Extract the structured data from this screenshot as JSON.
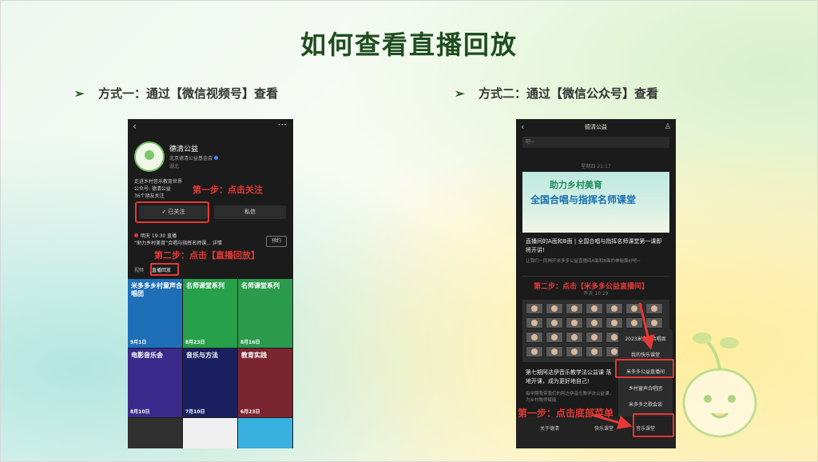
{
  "slide": {
    "title": "如何查看直播回放",
    "method1": "方式一：通过【微信视频号】查看",
    "method2": "方式二：通过【微信公众号】查看",
    "bullet": "➢"
  },
  "phone1": {
    "back": "‹",
    "more": "···",
    "account_name": "德清公益",
    "org": "北京德清公益基金会",
    "location": "湖北",
    "desc1": "走进乡村音乐教育世界",
    "desc2": "公众号: 德清公益",
    "desc3": "36个朋友关注",
    "follow_label": "✓ 已关注",
    "message_label": "私信",
    "live_line1": "明天 19:30 直播",
    "live_line2": "“助力乡村美育”合唱与指挥名师课... 详情",
    "book_label": "预约",
    "tabs": [
      "视频",
      "直播回放"
    ],
    "step1": "第一步：点击关注",
    "step2": "第二步：点击【直播回放】",
    "thumbs": [
      {
        "caption": "米多多乡村童声合唱团",
        "date": "9月1日",
        "color": "#1e6fb8"
      },
      {
        "caption": "名师课堂系列",
        "date": "8月23日",
        "color": "#27a04a"
      },
      {
        "caption": "名师课堂系列",
        "date": "8月16日",
        "color": "#2b9a4c"
      },
      {
        "caption": "电影音乐会",
        "date": "8月10日",
        "color": "#3a2a8c"
      },
      {
        "caption": "音乐与方法",
        "date": "7月10日",
        "color": "#1a2060"
      },
      {
        "caption": "教育实践",
        "date": "6月23日",
        "color": "#7a2530"
      },
      {
        "caption": "",
        "date": "",
        "color": "#303030"
      },
      {
        "caption": "",
        "date": "",
        "color": "#f0f0f0"
      },
      {
        "caption": "",
        "date": "",
        "color": "#3ab0e0"
      }
    ]
  },
  "phone2": {
    "back": "‹",
    "header_title": "德清公益",
    "user_icon": "♙",
    "bubble": "吧~",
    "time1": "星期四 21:17",
    "banner_line1": "助力乡村美育",
    "banner_line2": "全国合唱与指挥名师课堂",
    "article_title": "直播间的A面和B面 | 全国合唱与指挥名师课堂第一课即将开讲!",
    "article_sub": "让我们一同揭开米多多公益直播间A面和B面的神秘面纱吧~",
    "step3": "第二步：点击【米多多公益直播间】",
    "time2": "昨天 10:29",
    "article2_title": "第七期阿达伊音乐教学法公益课 落地开课，成为更好地自己!",
    "article2_sub": "每学期我带我们的阿达伊音乐教学法公益课，为乡村教师赋能",
    "menu": [
      "2023米多多合唱周",
      "我的快乐课堂",
      "米多多公益直播间",
      "乡村童声合唱团",
      "米多多之歌会谈"
    ],
    "bottom": [
      "关于德清",
      "快乐课堂",
      "音乐课堂"
    ],
    "step4": "第一步：点击底部菜单"
  }
}
